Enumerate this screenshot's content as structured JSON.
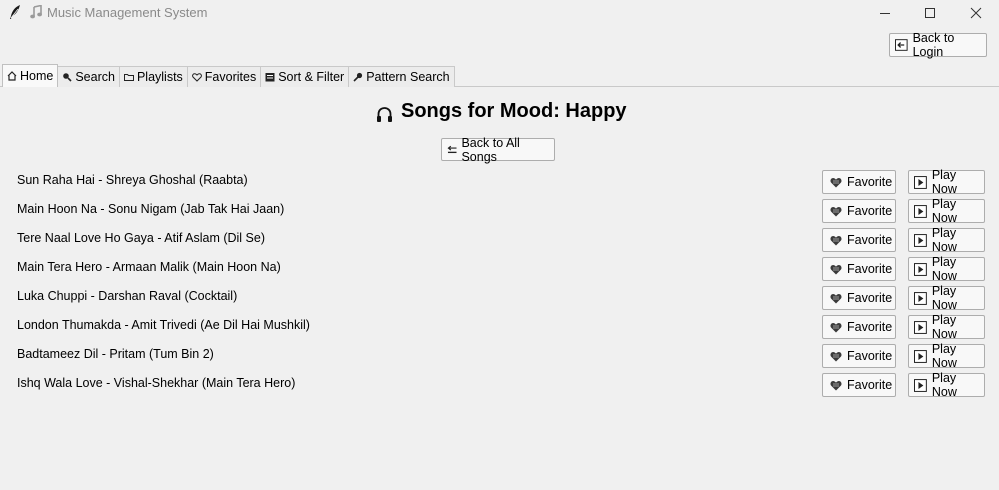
{
  "window": {
    "title": "Music Management System",
    "app_icon": "feather-icon",
    "title_icon": "music-note-icon",
    "controls": [
      "minimize-icon",
      "maximize-icon",
      "close-icon"
    ]
  },
  "header": {
    "back_to_login_label": "Back to Login",
    "back_to_login_icon": "back-arrow-icon"
  },
  "tabs": [
    {
      "label": "Home",
      "icon": "home-icon",
      "active": true
    },
    {
      "label": "Search",
      "icon": "magnifier-icon",
      "active": false
    },
    {
      "label": "Playlists",
      "icon": "folder-icon",
      "active": false
    },
    {
      "label": "Favorites",
      "icon": "heart-icon",
      "active": false
    },
    {
      "label": "Sort & Filter",
      "icon": "filter-icon",
      "active": false
    },
    {
      "label": "Pattern Search",
      "icon": "key-icon",
      "active": false
    }
  ],
  "main": {
    "heading": "Songs for Mood: Happy",
    "heading_icon": "headphones-icon",
    "back_to_all_label": "Back to All Songs",
    "back_to_all_icon": "back-arrow-icon",
    "favorite_label": "Favorite",
    "favorite_icon": "heart-icon",
    "play_label": "Play Now",
    "play_icon": "play-icon",
    "songs": [
      "Sun Raha Hai - Shreya Ghoshal (Raabta)",
      "Main Hoon Na - Sonu Nigam (Jab Tak Hai Jaan)",
      "Tere Naal Love Ho Gaya - Atif Aslam (Dil Se)",
      "Main Tera Hero - Armaan Malik (Main Hoon Na)",
      "Luka Chuppi - Darshan Raval (Cocktail)",
      "London Thumakda - Amit Trivedi (Ae Dil Hai Mushkil)",
      "Badtameez Dil - Pritam (Tum Bin 2)",
      "Ishq Wala Love - Vishal-Shekhar (Main Tera Hero)"
    ]
  },
  "colors": {
    "window_bg": "#f0f0f0",
    "button_bg": "#f8f8f8",
    "button_border": "#adadad",
    "title_text": "#8a8a8a"
  }
}
